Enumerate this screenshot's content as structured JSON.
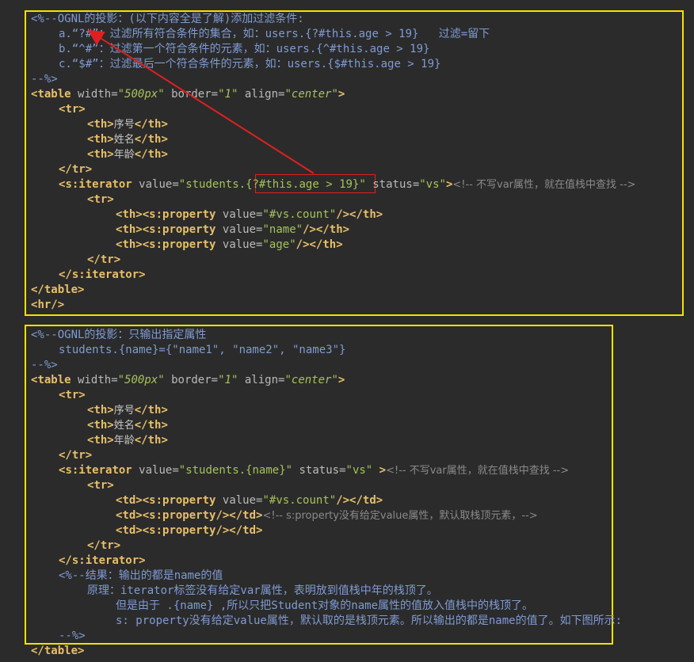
{
  "block1": {
    "comment_open": "<%--OGNL的投影：(以下内容全是了解)添加过滤条件:",
    "item_a_prefix": "a.“?#”：过滤所有符合条件的集合，如：",
    "item_a_code": "users.{?#this.age > 19}",
    "item_a_note": "过滤=留下",
    "item_b_prefix": "b.“^#”：过滤第一个符合条件的元素，如：",
    "item_b_code": "users.{^#this.age > 19}",
    "item_c_prefix": "c.“$#”：过滤最后一个符合条件的元素，如：",
    "item_c_code": "users.{$#this.age > 19}",
    "comment_close": "--%>",
    "table_open": {
      "tag": "table",
      "a1": "width",
      "v1": "500px",
      "a2": "border",
      "v2": "1",
      "a3": "align",
      "v3": "center"
    },
    "tr": "tr",
    "th": "th",
    "th_labels": [
      "序号",
      "姓名",
      "年龄"
    ],
    "iterator_tag": "s:iterator",
    "iterator_value_attr": "value",
    "iterator_value_pre": "\"students.",
    "iterator_value_hl": "{?#this.age > 19}",
    "iterator_value_post": "\"",
    "status_attr": "status",
    "status_val": "\"vs\"",
    "iterator_comment": "<!-- 不写var属性，就在值栈中查找 -->",
    "property_tag": "s:property",
    "prop_values": [
      "\"#vs.count\"",
      "\"name\"",
      "\"age\""
    ],
    "hr": "hr"
  },
  "block2": {
    "comment_open": "<%--OGNL的投影：只输出指定属性",
    "projection_line": "students.{name}={\"name1\", \"name2\", \"name3\"}",
    "comment_close": "--%>",
    "iterator_value": "\"students.{name}\"",
    "status_val": "\"vs\"",
    "iterator_comment": "<!-- 不写var属性，就在值栈中查找 -->",
    "td": "td",
    "prop_value": "\"#vs.count\"",
    "td2_comment": "<!-- s:property没有给定value属性，默认取栈顶元素，-->",
    "result_open": "<%--结果：输出的都是name的值",
    "reason_1": "原理：iterator标签没有给定var属性，表明放到值栈中年的栈顶了。",
    "reason_2": "但是由于 .{name} ,所以只把Student对象的name属性的值放入值栈中的栈顶了。",
    "reason_3": "s: property没有给定value属性，默认取的是栈顶元素。所以输出的都是name的值了。如下图所示:",
    "result_close": "--%>"
  }
}
